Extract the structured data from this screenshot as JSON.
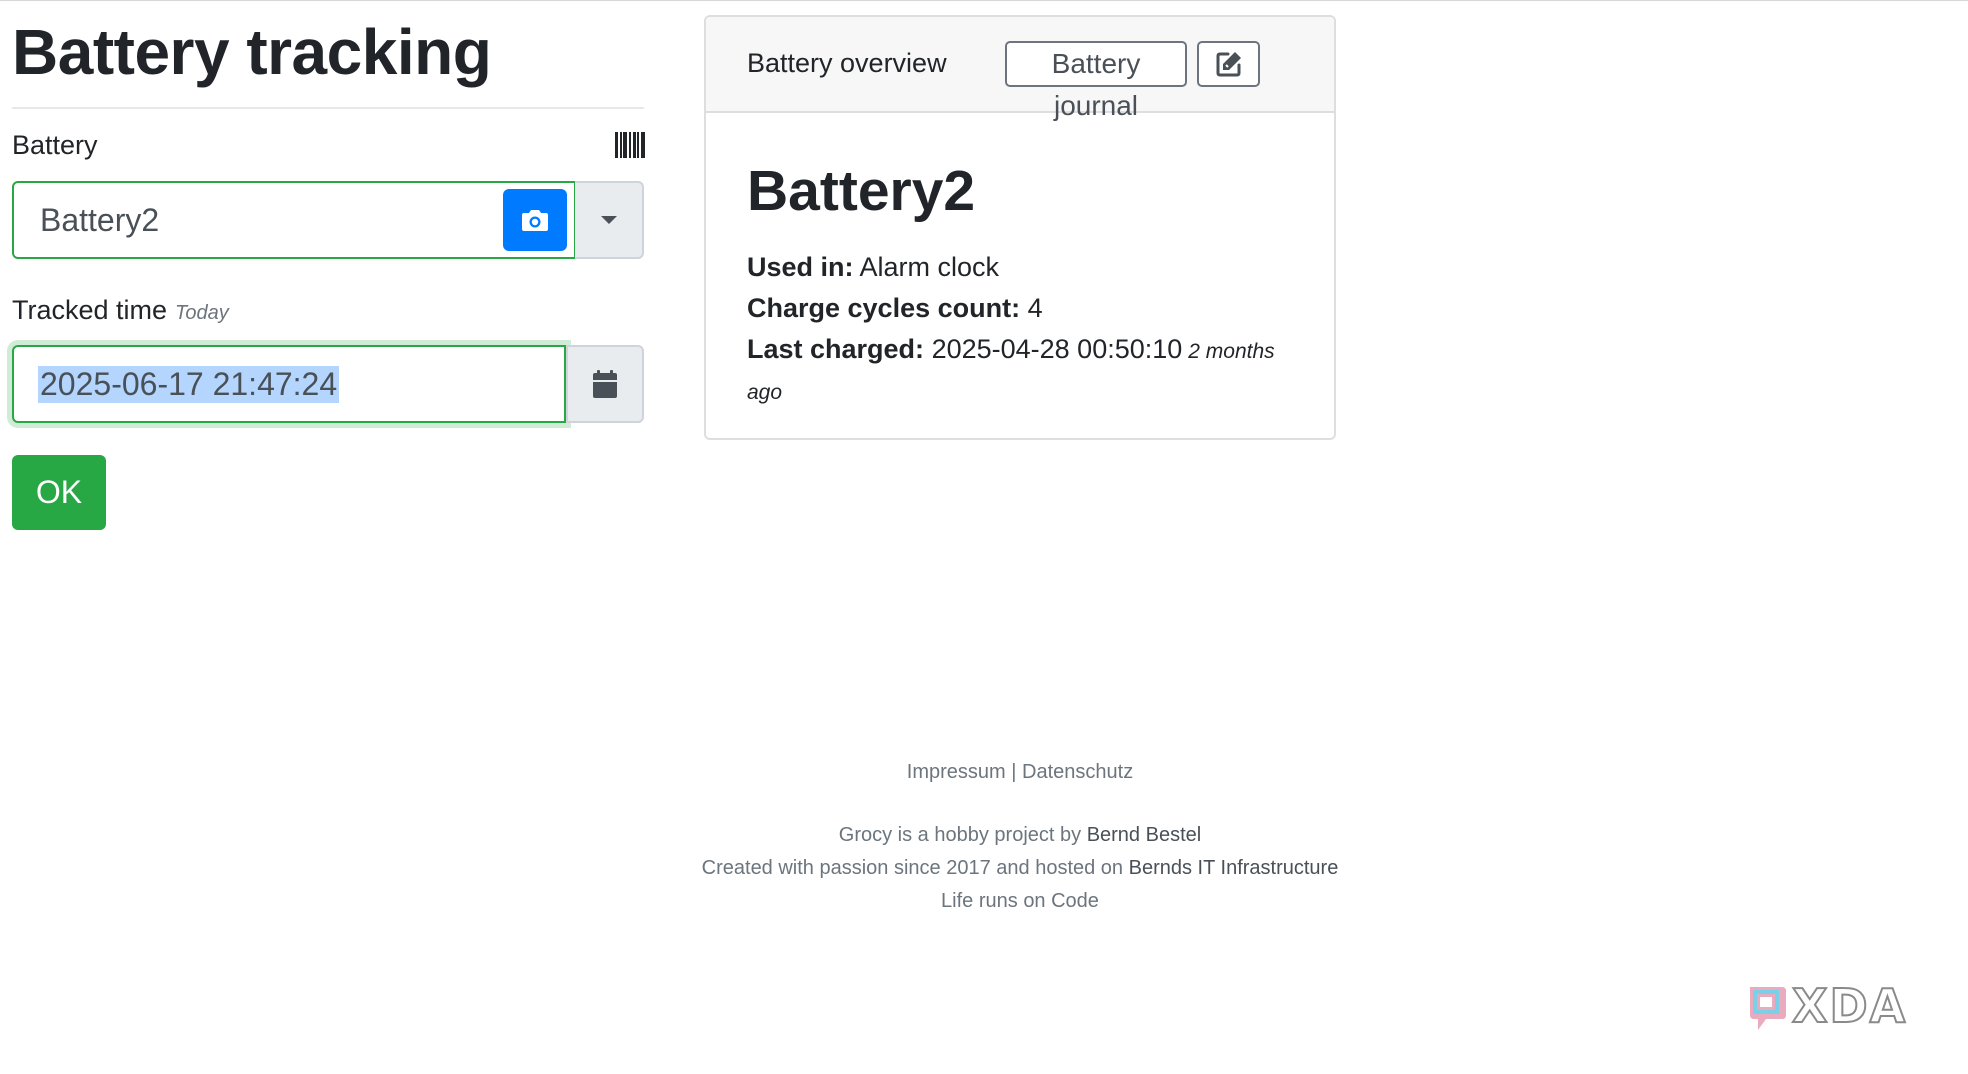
{
  "page": {
    "title": "Battery tracking"
  },
  "form": {
    "battery_label": "Battery",
    "battery_value": "Battery2",
    "tracked_time_label": "Tracked time",
    "tracked_time_hint": "Today",
    "tracked_time_value": "2025-06-17 21:47:24",
    "ok_label": "OK"
  },
  "icons": {
    "barcode": "barcode-icon",
    "camera": "camera-icon",
    "dropdown": "caret-down-icon",
    "calendar": "calendar-icon",
    "edit": "edit-icon"
  },
  "card": {
    "header_title": "Battery overview",
    "journal_label": "Battery journal",
    "battery_name": "Battery2",
    "used_in_label": "Used in:",
    "used_in_value": "Alarm clock",
    "charge_cycles_label": "Charge cycles count:",
    "charge_cycles_value": "4",
    "last_charged_label": "Last charged:",
    "last_charged_value": "2025-04-28 00:50:10",
    "last_charged_relative_a": "2 months",
    "last_charged_relative_b": "ago"
  },
  "footer": {
    "impressum": "Impressum",
    "separator": "|",
    "datenschutz": "Datenschutz",
    "line1_text": "Grocy is a hobby project by",
    "line1_link": "Bernd Bestel",
    "line2_text": "Created with passion since 2017 and hosted on",
    "line2_link": "Bernds IT Infrastructure",
    "line3": "Life runs on Code"
  },
  "watermark": {
    "text": "XDA"
  },
  "colors": {
    "primary": "#007bff",
    "success": "#28a745",
    "selection": "#b4d5fe",
    "muted": "#6c757d"
  }
}
